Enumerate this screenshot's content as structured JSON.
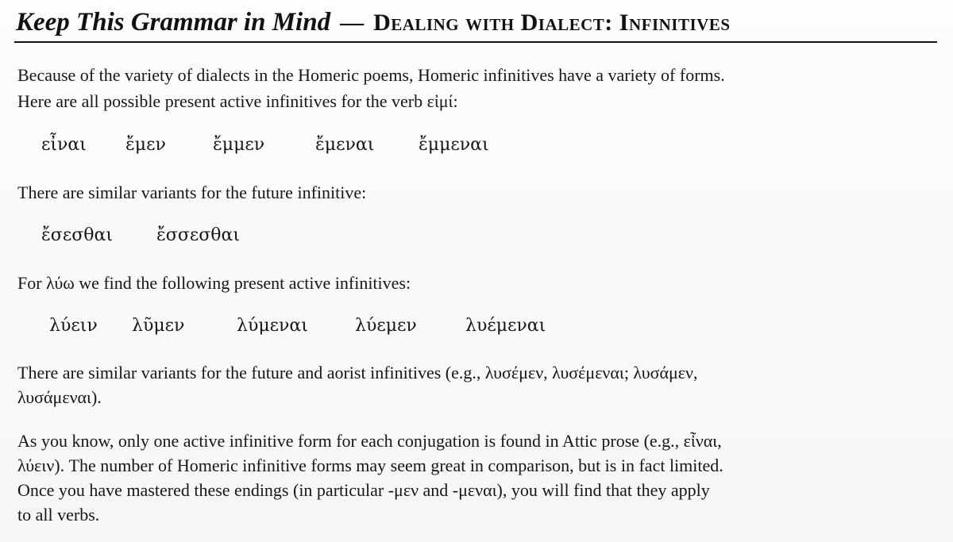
{
  "heading": {
    "main": "Keep This Grammar in Mind",
    "dash": "—",
    "sub": "Dealing with Dialect: Infinitives"
  },
  "paragraphs": {
    "p1_line1": "Because of the variety of dialects in the Homeric poems, Homeric infinitives have a variety of forms.",
    "p1_line2": "Here are all possible present active infinitives for the verb εἰμί:",
    "p2": "There are similar variants for the future infinitive:",
    "p3": "For λύω we find the following present active infinitives:",
    "p4_line1": "There are similar variants for the future and aorist infinitives (e.g., λυσέμεν, λυσέμεναι; λυσάμεν,",
    "p4_line2": "λυσάμεναι).",
    "p5_line1": "As you know, only one active infinitive form for each conjugation is found in Attic prose (e.g., εἶναι,",
    "p5_line2": "λύειν). The number of Homeric infinitive forms may seem great in comparison, but is in fact limited.",
    "p5_line3": "Once you have mastered these endings (in particular -μεν and -μεναι), you will find that they apply",
    "p5_line4": "to all verbs."
  },
  "forms": {
    "eimi": [
      "εἶναι",
      "ἔμεν",
      "ἔμμεν",
      "ἔμεναι",
      "ἔμμεναι"
    ],
    "future": [
      "ἔσεσθαι",
      "ἔσσεσθαι"
    ],
    "luo": [
      "λύειν",
      "λῦμεν",
      "λύμεναι",
      "λύεμεν",
      "λυέμεναι"
    ]
  }
}
